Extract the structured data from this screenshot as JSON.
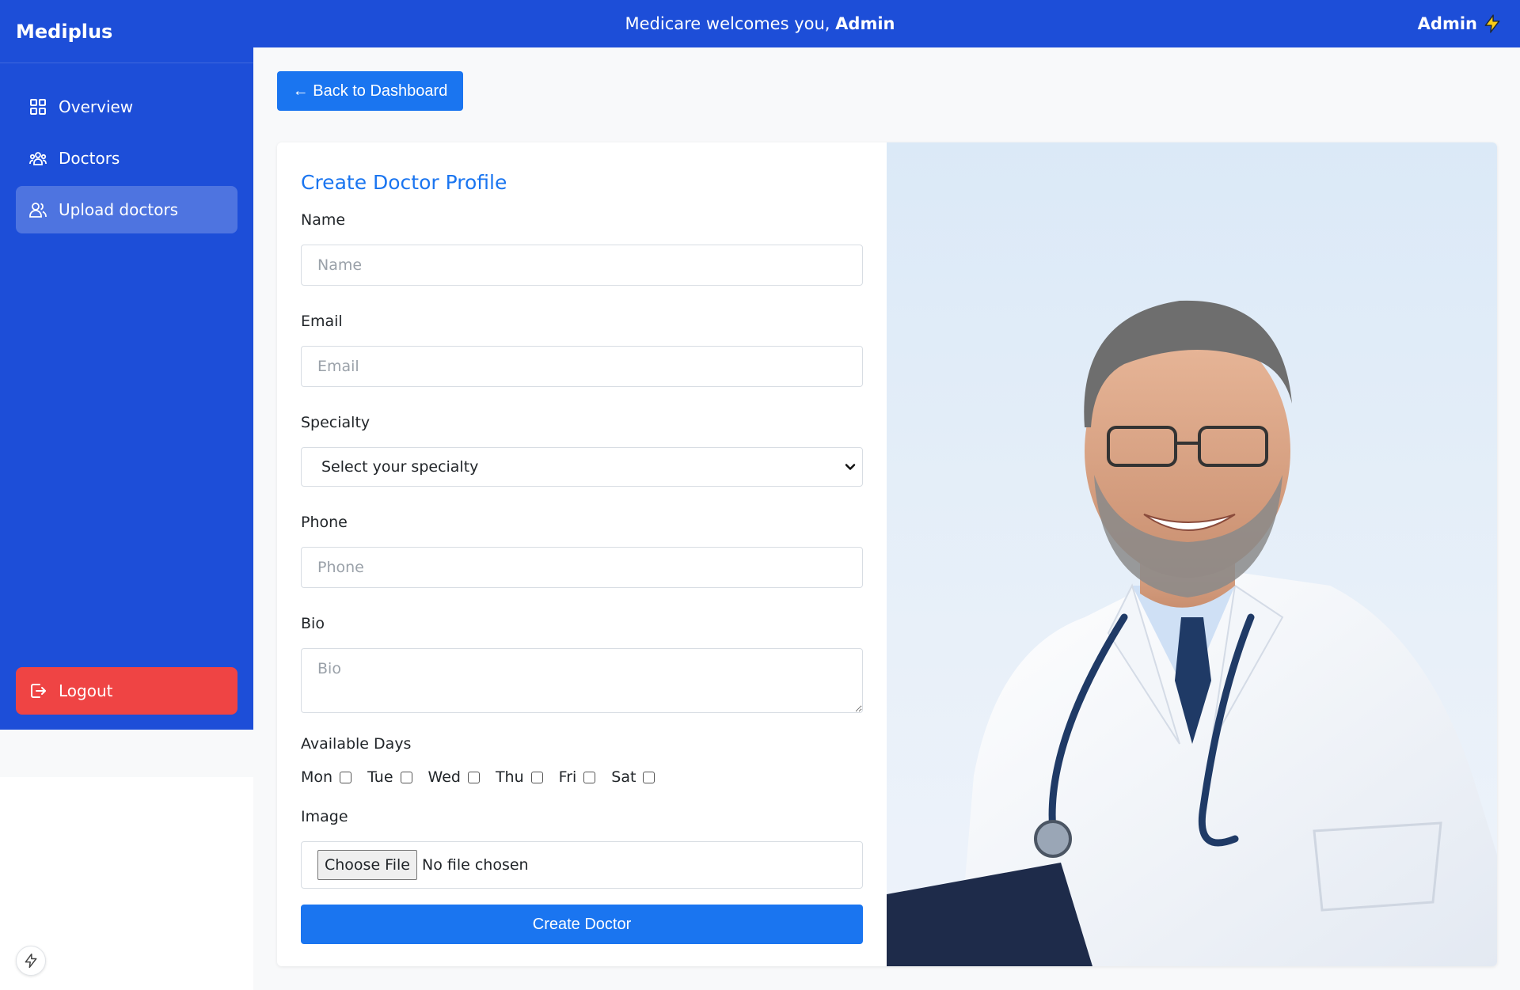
{
  "app": {
    "brand": "Mediplus",
    "welcome_prefix": "Medicare welcomes you, ",
    "welcome_user": "Admin",
    "user_label": "Admin"
  },
  "sidebar": {
    "items": [
      {
        "label": "Overview",
        "icon": "grid-icon",
        "active": false
      },
      {
        "label": "Doctors",
        "icon": "users-group-icon",
        "active": false
      },
      {
        "label": "Upload doctors",
        "icon": "users-icon",
        "active": true
      }
    ],
    "logout_label": "Logout"
  },
  "main": {
    "back_label": "← Back to Dashboard",
    "form": {
      "title": "Create Doctor Profile",
      "name": {
        "label": "Name",
        "placeholder": "Name",
        "value": ""
      },
      "email": {
        "label": "Email",
        "placeholder": "Email",
        "value": ""
      },
      "specialty": {
        "label": "Specialty",
        "selected": "Select your specialty"
      },
      "phone": {
        "label": "Phone",
        "placeholder": "Phone",
        "value": ""
      },
      "bio": {
        "label": "Bio",
        "placeholder": "Bio",
        "value": ""
      },
      "available_days": {
        "label": "Available Days",
        "days": [
          "Mon",
          "Tue",
          "Wed",
          "Thu",
          "Fri",
          "Sat"
        ]
      },
      "image": {
        "label": "Image",
        "button_label": "Choose File",
        "status": "No file chosen"
      },
      "submit_label": "Create Doctor"
    }
  },
  "colors": {
    "primary": "#1d4ed8",
    "accent": "#1a75f0",
    "danger": "#ef4444",
    "background": "#f8f9fa"
  }
}
